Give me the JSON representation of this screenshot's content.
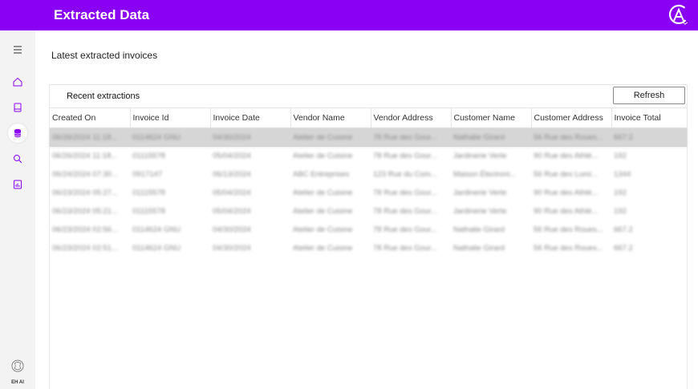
{
  "header": {
    "title": "Extracted Data",
    "accent": "#8a00f5"
  },
  "sidebar": {
    "items": [
      {
        "icon": "menu-icon"
      },
      {
        "icon": "home-icon"
      },
      {
        "icon": "document-icon"
      },
      {
        "icon": "database-icon",
        "active": true
      },
      {
        "icon": "search-icon"
      },
      {
        "icon": "report-icon"
      }
    ],
    "brand": "EH AI"
  },
  "page": {
    "title": "Latest extracted invoices"
  },
  "panel": {
    "title": "Recent extractions",
    "refresh_label": "Refresh"
  },
  "table": {
    "columns": [
      "Created On",
      "Invoice Id",
      "Invoice Date",
      "Vendor Name",
      "Vendor Address",
      "Customer Name",
      "Customer Address",
      "Invoice Total"
    ],
    "rows": [
      [
        "06/26/2024 11:18...",
        "0114624 GNU",
        "04/30/2024",
        "Atelier de Cuisine",
        "78 Rue des Gour...",
        "Nathalie Girard",
        "56 Rue des Roues...",
        "667.2"
      ],
      [
        "06/26/2024 11:18...",
        "01115578",
        "05/04/2024",
        "Atelier de Cuisine",
        "78 Rue des Gour...",
        "Jardinerie Verte",
        "90 Rue des Athlé...",
        "192"
      ],
      [
        "06/24/2024 07:30...",
        "0917147",
        "06/13/2024",
        "ABC Entreprises",
        "123 Rue du Com...",
        "Maison Électroni...",
        "56 Rue des Lumi...",
        "1344"
      ],
      [
        "06/23/2024 05:27...",
        "01115578",
        "05/04/2024",
        "Atelier de Cuisine",
        "78 Rue des Gour...",
        "Jardinerie Verte",
        "90 Rue des Athlé...",
        "192"
      ],
      [
        "06/23/2024 05:21...",
        "01115578",
        "05/04/2024",
        "Atelier de Cuisine",
        "78 Rue des Gour...",
        "Jardinerie Verte",
        "90 Rue des Athlé...",
        "192"
      ],
      [
        "06/23/2024 02:56...",
        "0114624 GNU",
        "04/30/2024",
        "Atelier de Cuisine",
        "78 Rue des Gour...",
        "Nathalie Girard",
        "56 Rue des Roues...",
        "667.2"
      ],
      [
        "06/23/2024 02:51...",
        "0114624 GNU",
        "04/30/2024",
        "Atelier de Cuisine",
        "78 Rue des Gour...",
        "Nathalie Girard",
        "56 Rue des Roues...",
        "667.2"
      ]
    ],
    "selected_row": 0
  }
}
